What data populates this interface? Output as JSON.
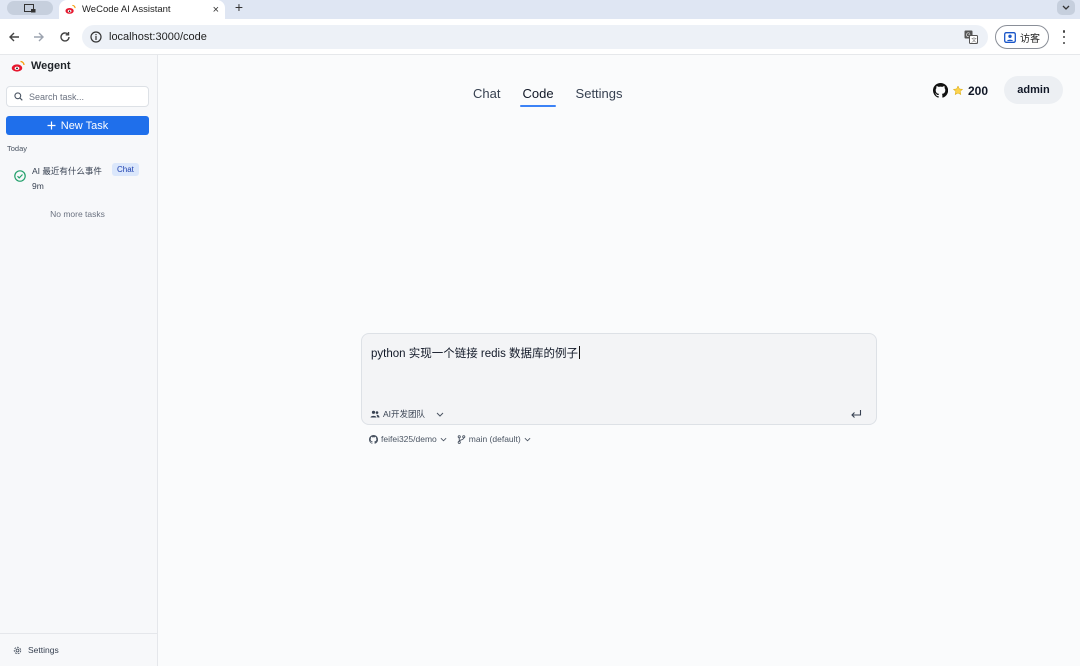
{
  "browser": {
    "tab_title": "WeCode AI Assistant",
    "tab_close": "×",
    "new_tab": "+",
    "url": "localhost:3000/code",
    "guest_label": "访客"
  },
  "sidebar": {
    "brand": "Wegent",
    "search_placeholder": "Search task...",
    "new_task_label": "New Task",
    "section_today": "Today",
    "tasks": [
      {
        "title": "AI 最近有什么事件",
        "time": "9m",
        "badge": "Chat"
      }
    ],
    "no_more": "No more tasks",
    "footer_settings": "Settings"
  },
  "header": {
    "nav": [
      "Chat",
      "Code",
      "Settings"
    ],
    "active_nav": "Code",
    "stars": "200",
    "user": "admin"
  },
  "composer": {
    "input_text": "python 实现一个链接 redis 数据库的例子",
    "team": "AI开发团队",
    "repo": "feifei325/demo",
    "branch": "main (default)"
  },
  "colors": {
    "accent": "#1f6feb",
    "badge_bg": "#dbe7fb",
    "success": "#22a06b"
  }
}
